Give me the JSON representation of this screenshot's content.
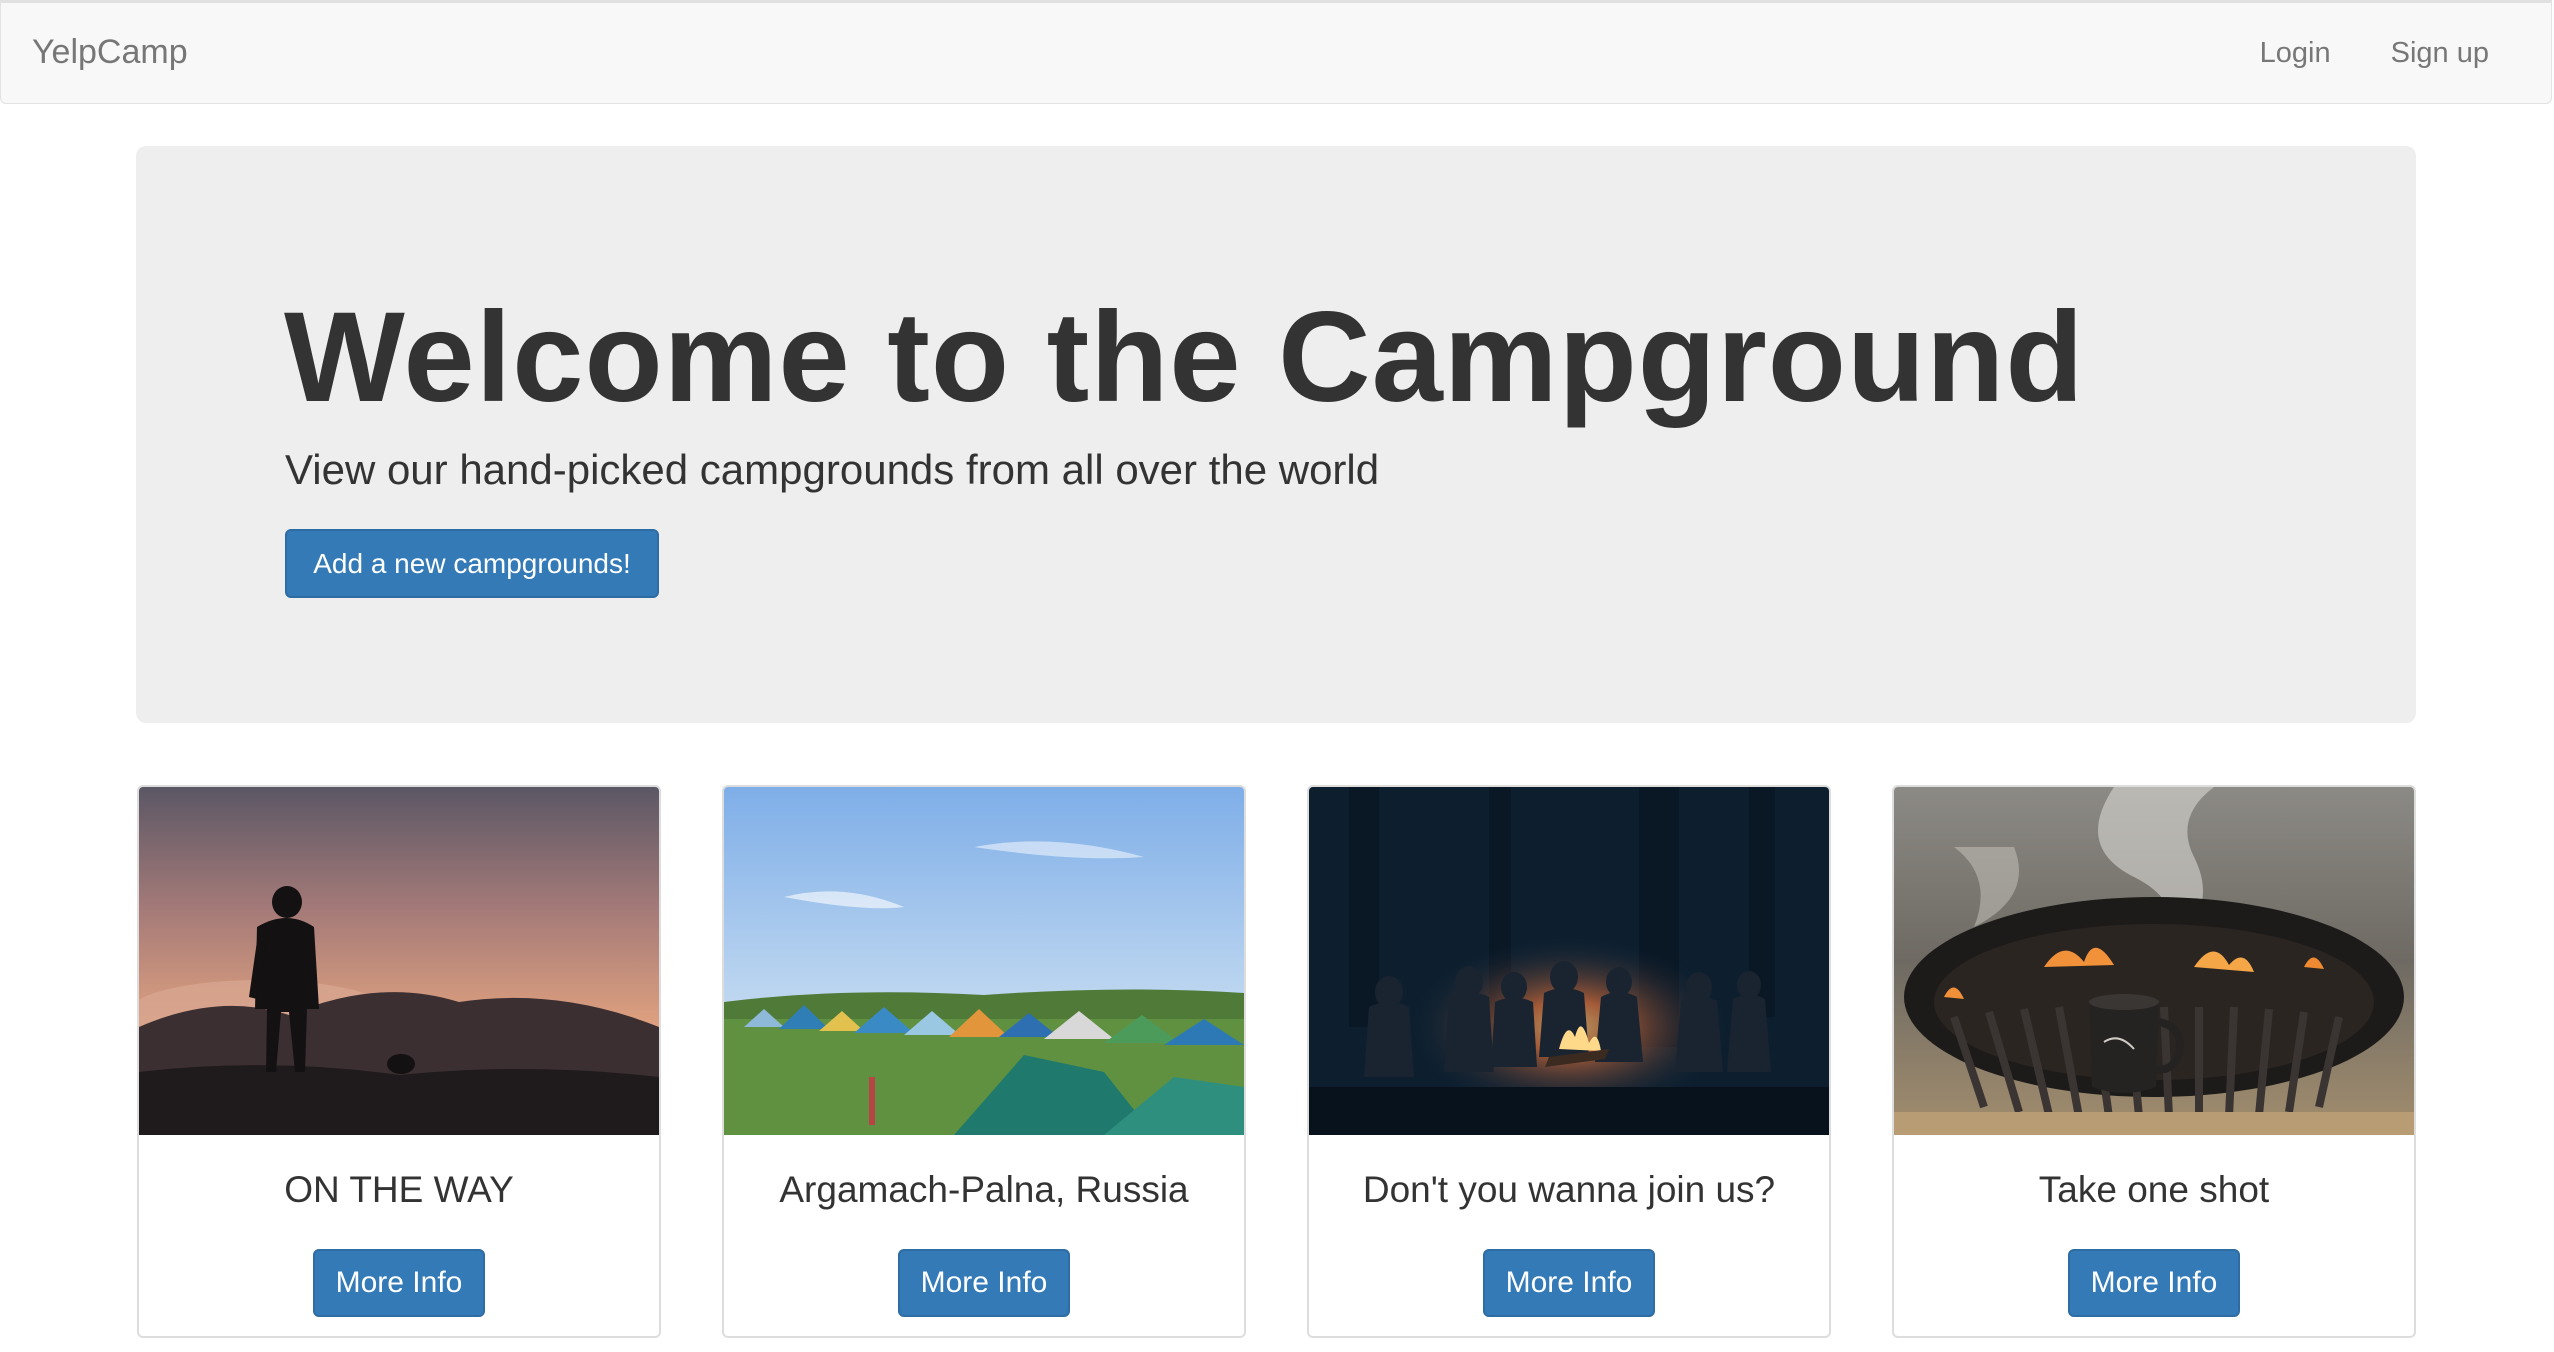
{
  "navbar": {
    "brand": "YelpCamp",
    "login_label": "Login",
    "signup_label": "Sign up"
  },
  "jumbotron": {
    "title": "Welcome to the Campground",
    "subtitle": "View our hand-picked campgrounds from all over the world",
    "add_button_label": "Add a new campgrounds!"
  },
  "campgrounds": [
    {
      "name": "ON THE WAY",
      "button_label": "More Info",
      "image": "hiker-silhouette-at-sunset"
    },
    {
      "name": "Argamach-Palna, Russia",
      "button_label": "More Info",
      "image": "tents-in-green-field"
    },
    {
      "name": "Don't you wanna join us?",
      "button_label": "More Info",
      "image": "campfire-at-night"
    },
    {
      "name": "Take one shot",
      "button_label": "More Info",
      "image": "grill-fire-with-mug"
    }
  ],
  "colors": {
    "primary": "#337ab7",
    "navbar_bg": "#f8f8f8",
    "jumbotron_bg": "#eeeeee",
    "text": "#333333",
    "nav_text": "#777777"
  }
}
